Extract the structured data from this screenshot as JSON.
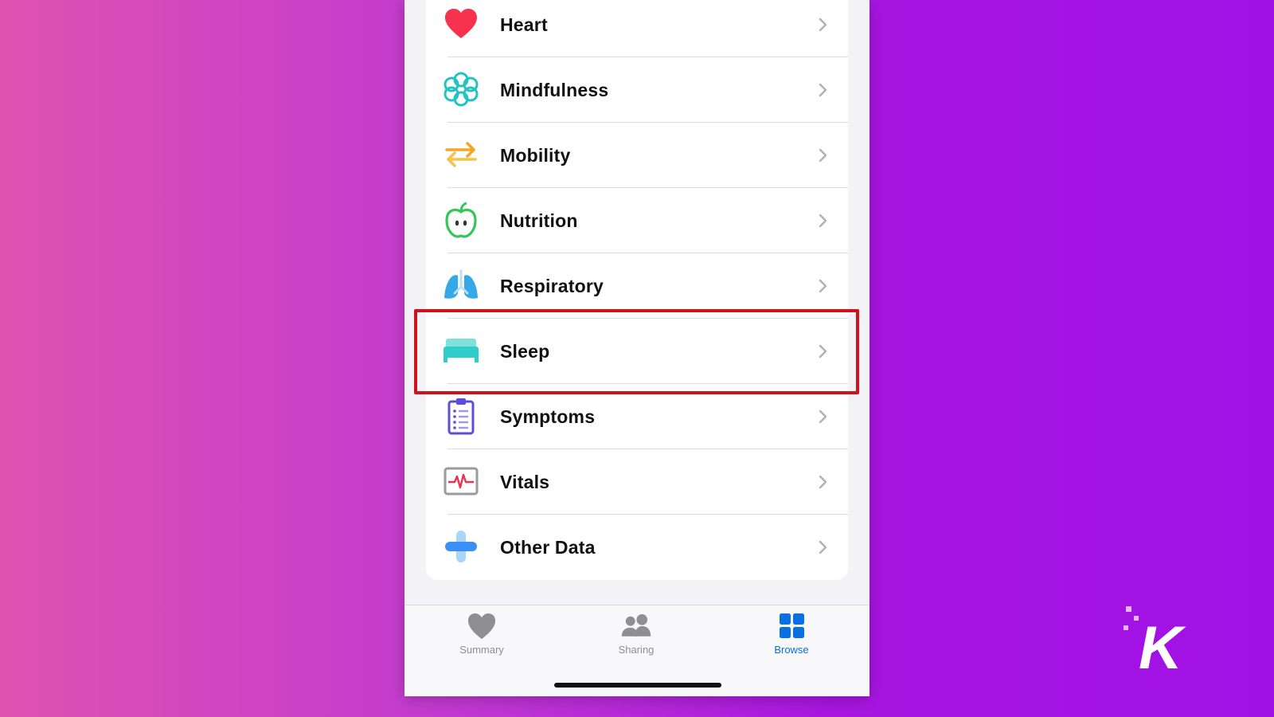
{
  "categories": [
    {
      "label": "Heart",
      "icon": "heart-icon",
      "color": "#f7324f"
    },
    {
      "label": "Mindfulness",
      "icon": "mindfulness-icon",
      "color": "#22c3c2"
    },
    {
      "label": "Mobility",
      "icon": "mobility-arrows-icon",
      "color": "#f5a524"
    },
    {
      "label": "Nutrition",
      "icon": "apple-icon",
      "color": "#33c758"
    },
    {
      "label": "Respiratory",
      "icon": "lungs-icon",
      "color": "#35a8e8"
    },
    {
      "label": "Sleep",
      "icon": "bed-icon",
      "color": "#2ecdc9"
    },
    {
      "label": "Symptoms",
      "icon": "clipboard-icon",
      "color": "#5b4fd6"
    },
    {
      "label": "Vitals",
      "icon": "vitals-monitor-icon",
      "color": "#e8324f"
    },
    {
      "label": "Other Data",
      "icon": "plus-icon",
      "color": "#3b8ff5"
    }
  ],
  "highlighted_category": "Sleep",
  "highlight_color": "#d0121b",
  "tabbar": {
    "tabs": [
      {
        "label": "Summary",
        "icon": "heart-tab-icon",
        "active": false
      },
      {
        "label": "Sharing",
        "icon": "people-icon",
        "active": false
      },
      {
        "label": "Browse",
        "icon": "grid-icon",
        "active": true
      }
    ],
    "active_color": "#0a6fe0"
  },
  "watermark": {
    "text": "K"
  }
}
